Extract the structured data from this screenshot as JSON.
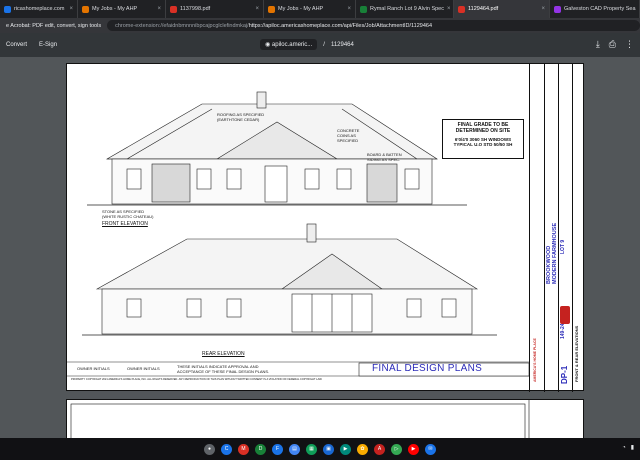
{
  "browser": {
    "tabs": [
      {
        "label": "ricashomeplace.com",
        "color": "#1a73e8",
        "active": false
      },
      {
        "label": "My Jobs - My AHP",
        "color": "#e37400",
        "active": false
      },
      {
        "label": "1137998.pdf",
        "color": "#d93025",
        "active": false
      },
      {
        "label": "My Jobs - My AHP",
        "color": "#e37400",
        "active": false
      },
      {
        "label": "Rymal Ranch Lot 9 Alvin Spec",
        "color": "#188038",
        "active": false
      },
      {
        "label": "1129464.pdf",
        "color": "#d93025",
        "active": true
      },
      {
        "label": "Galveston CAD Property Sea",
        "color": "#9334e6",
        "active": false
      }
    ],
    "extension_label": "e Acrobat: PDF edit, convert, sign tools",
    "url_scheme": "chrome-extension://efaidnbmnnnibpcajpcglclefindmkaj/",
    "url_rest": "https://apiloc.americashomeplace.com/api/Files/Job/AttachmentID/1129464"
  },
  "pdf_toolbar": {
    "convert_label": "Convert",
    "esign_label": "E-Sign",
    "source_label": "apiloc.americ...",
    "separator": "/",
    "file_label": "1129464",
    "icons": [
      "download-icon",
      "print-icon",
      "more-vert-icon"
    ]
  },
  "sheet": {
    "front_elevation": "FRONT ELEVATION",
    "rear_elevation": "REAR ELEVATION",
    "note_grade": "FINAL GRADE TO BE\nDETERMINED ON SITE",
    "note_windows": "6'0/4'0 3060 SH WINDOWS\nTYPICAL U.O STD 50/50 SH",
    "plans_title": "FINAL DESIGN PLANS",
    "initials_owner1": "OWNER INITIALS",
    "initials_owner2": "OWNER INITIALS",
    "approval_note": "THESE INITIALS INDICATE APPROVAL AND\nACCEPTANCE OF THESE FINAL DESIGN PLANS.",
    "copyright_note": "PROPERTY COPYRIGHT 2021 AMERICA'S HOME PLACE, INC. ALL RIGHTS RESERVED. ANY REPRODUCTION OF THIS PLAN WITHOUT WRITTEN CONSENT IS A VIOLATION OF FEDERAL COPYRIGHT LAW.",
    "plan_name": "BROOKWOOD\nMODERN FARMHOUSE",
    "lot": "LOT 9",
    "job_number": "149-24-021",
    "sheet_id": "DP-1",
    "sheet_desc": "FRONT & REAR ELEVATIONS",
    "brand": "AMERICA'S HOME PLACE",
    "callout_roof": "ROOFING AS SPECIFIED\n(EARTHTONE CEDAR)",
    "callout_concrete": "CONCRETE\nCOINS AS\nSPECIFIED",
    "callout_siding": "BOARD & BATTEN\nSIDING AS SPEC.",
    "callout_stone": "STONE AS SPECIFIED\n(WHITE RUSTIC CHATEAU)"
  }
}
